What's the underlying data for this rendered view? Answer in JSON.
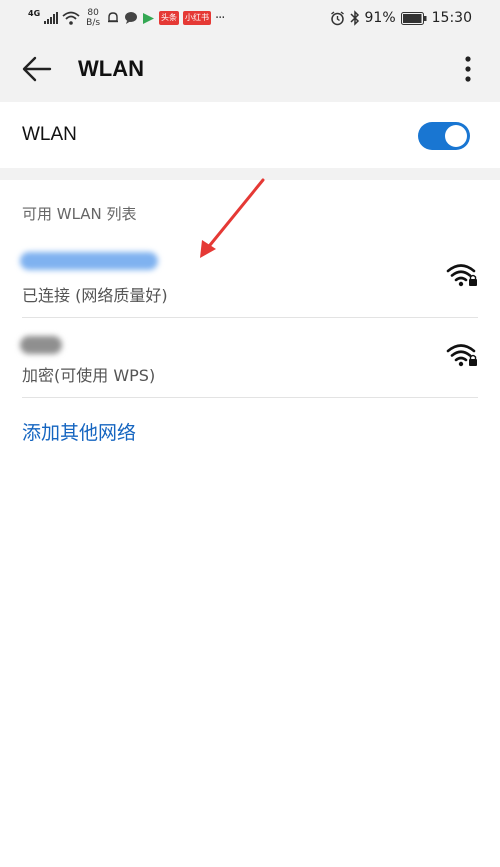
{
  "status_bar": {
    "network_type": "4G",
    "speed_value": "80",
    "speed_unit": "B/s",
    "app_badge_1": "头条",
    "app_badge_2": "小红书",
    "more_dots": "···",
    "battery_percent": "91%",
    "time": "15:30"
  },
  "toolbar": {
    "title": "WLAN"
  },
  "wlan_toggle": {
    "label": "WLAN",
    "enabled": true,
    "accent_color": "#1976d2"
  },
  "networks": {
    "section_header": "可用 WLAN 列表",
    "items": [
      {
        "status": "已连接 (网络质量好)",
        "icon": "wifi-lock-icon"
      },
      {
        "status": "加密(可使用 WPS)",
        "icon": "wifi-lock-icon"
      }
    ],
    "add_network_label": "添加其他网络"
  },
  "annotation": {
    "arrow_color": "#e53935"
  }
}
